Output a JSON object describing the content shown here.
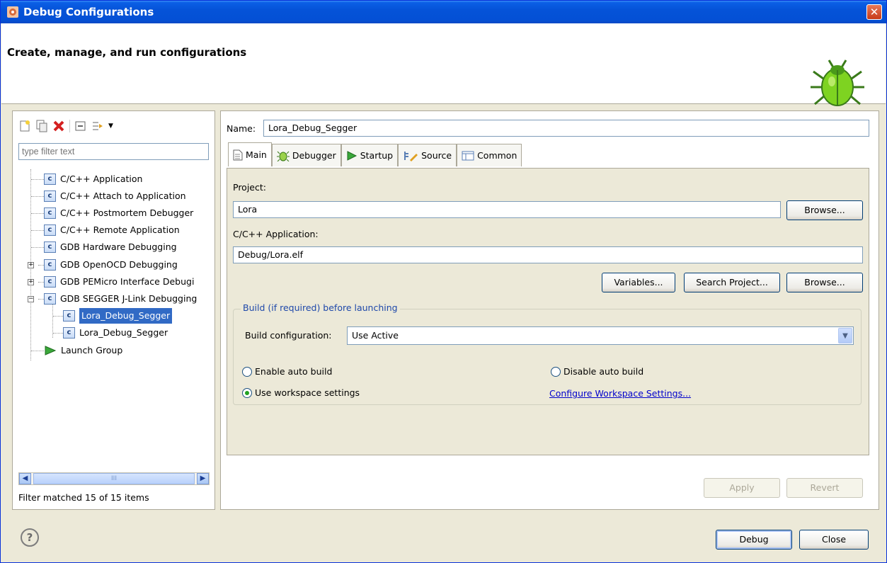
{
  "window": {
    "title": "Debug Configurations",
    "close_glyph": "✕",
    "banner_title": "Create, manage, and run configurations"
  },
  "left": {
    "toolbar_icons": [
      "new-config-icon",
      "duplicate-icon",
      "delete-icon",
      "collapse-all-icon",
      "filter-icon"
    ],
    "filter_placeholder": "type filter text",
    "tree": [
      {
        "label": "C/C++ Application"
      },
      {
        "label": "C/C++ Attach to Application"
      },
      {
        "label": "C/C++ Postmortem Debugger"
      },
      {
        "label": "C/C++ Remote Application"
      },
      {
        "label": "GDB Hardware Debugging"
      },
      {
        "label": "GDB OpenOCD Debugging"
      },
      {
        "label": "GDB PEMicro Interface Debugi"
      },
      {
        "label": "GDB SEGGER J-Link Debugging"
      },
      {
        "label": "Lora_Debug_Segger"
      },
      {
        "label": "Lora_Debug_Segger"
      },
      {
        "label": "Launch Group"
      }
    ],
    "scroll_thumb": "III",
    "status": "Filter matched 15 of 15 items"
  },
  "right": {
    "name_label": "Name:",
    "name_value": "Lora_Debug_Segger",
    "tabs": [
      "Main",
      "Debugger",
      "Startup",
      "Source",
      "Common"
    ],
    "project_label": "Project:",
    "project_value": "Lora",
    "browse_label": "Browse...",
    "app_label": "C/C++ Application:",
    "app_value": "Debug/Lora.elf",
    "variables_label": "Variables...",
    "search_project_label": "Search Project...",
    "build_group_label": "Build (if required) before launching",
    "build_config_label": "Build configuration:",
    "build_config_value": "Use Active",
    "enable_auto_build": "Enable auto build",
    "disable_auto_build": "Disable auto build",
    "use_workspace": "Use workspace settings",
    "configure_workspace": "Configure Workspace Settings...",
    "apply_label": "Apply",
    "revert_label": "Revert"
  },
  "footer": {
    "help_glyph": "?",
    "debug_label": "Debug",
    "close_label": "Close"
  }
}
